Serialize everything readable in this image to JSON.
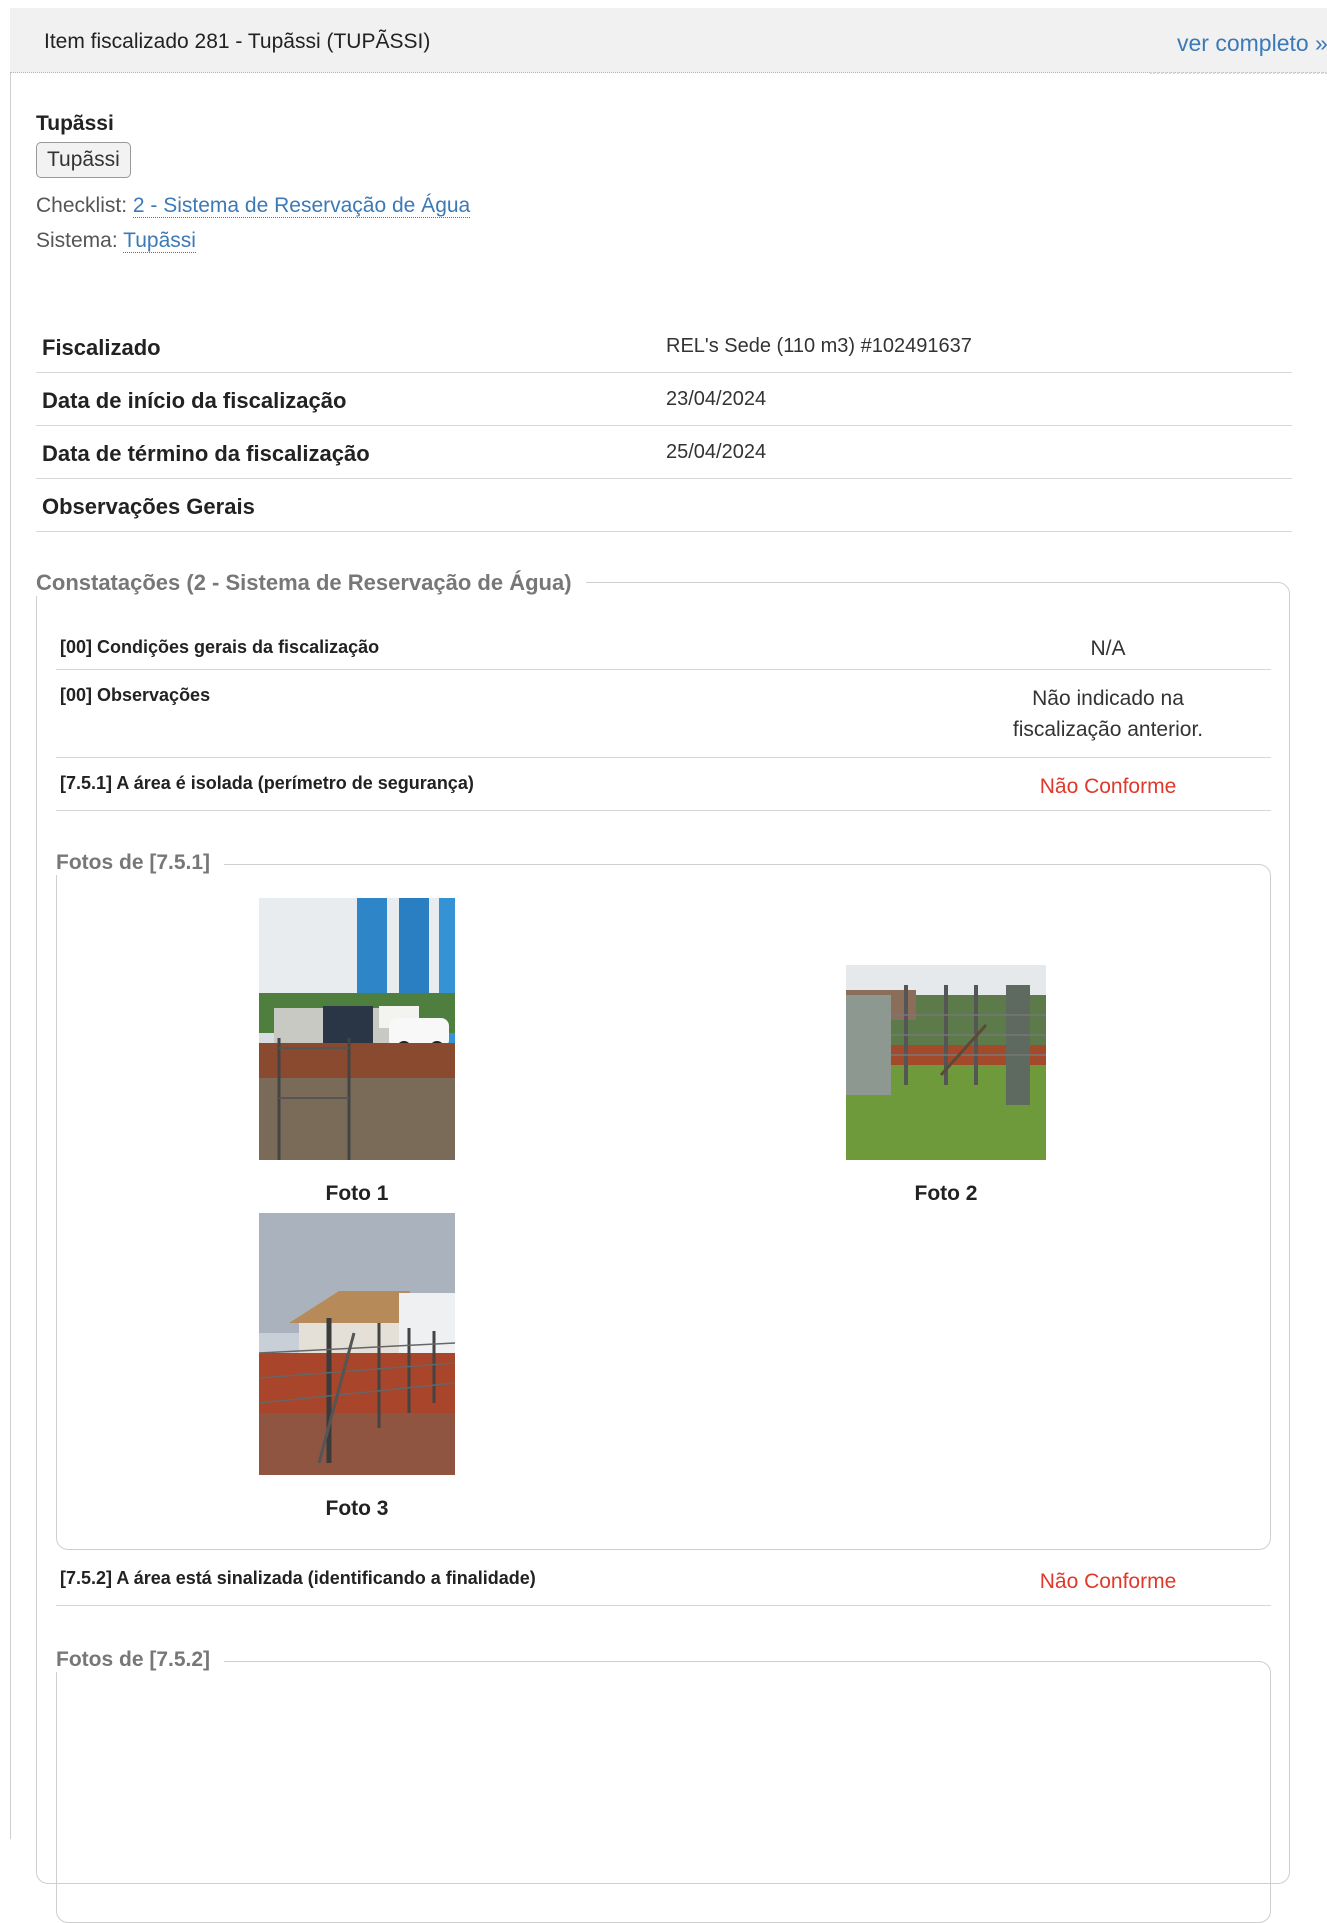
{
  "header": {
    "title": "Item fiscalizado 281 - Tupãssi (TUPÃSSI)",
    "link": "ver completo »"
  },
  "item": {
    "name": "Tupãssi",
    "chip": "Tupãssi",
    "checklist_label": "Checklist:",
    "checklist_value": "2 - Sistema de Reservação de Água",
    "sistema_label": "Sistema:",
    "sistema_value": "Tupãssi"
  },
  "details": [
    {
      "label": "Fiscalizado",
      "value": "REL's Sede (110 m3) #102491637"
    },
    {
      "label": "Data de início da fiscalização",
      "value": "23/04/2024"
    },
    {
      "label": "Data de término da fiscalização",
      "value": "25/04/2024"
    },
    {
      "label": "Observações Gerais",
      "value": ""
    }
  ],
  "constatacoes": {
    "legend": "Constatações (2 - Sistema de Reservação de Água)",
    "rows": [
      {
        "question": "[00] Condições gerais da fiscalização",
        "answer": "N/A"
      },
      {
        "question": "[00] Observações",
        "answer_line1": "Não indicado na",
        "answer_line2": "fiscalização anterior."
      },
      {
        "question": "[7.5.1] A área é isolada (perímetro de segurança)",
        "answer": "Não Conforme"
      },
      {
        "question": "[7.5.2] A área está sinalizada (identificando a finalidade)",
        "answer": "Não Conforme"
      }
    ],
    "photos_751": {
      "legend": "Fotos de [7.5.1]",
      "photos": [
        {
          "caption": "Foto 1"
        },
        {
          "caption": "Foto 2"
        },
        {
          "caption": "Foto 3"
        }
      ]
    },
    "photos_752": {
      "legend": "Fotos de [7.5.2]"
    }
  },
  "colors": {
    "link": "#3b79b7",
    "non_conform": "#e0392b"
  }
}
